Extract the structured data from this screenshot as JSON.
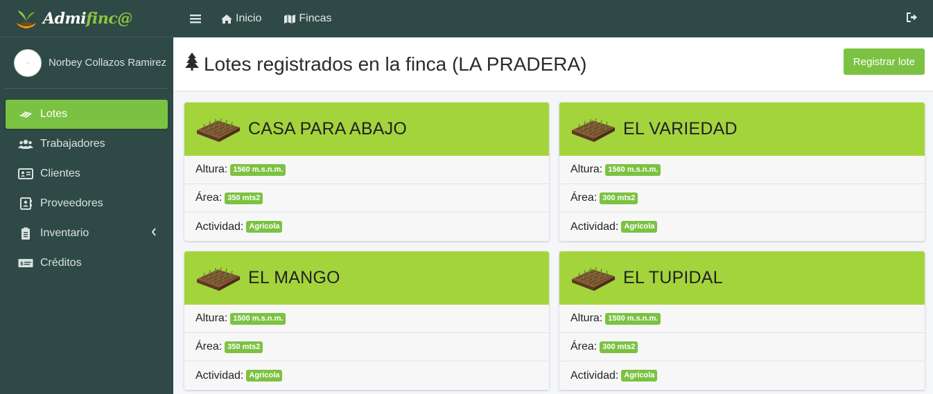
{
  "brand": {
    "name_part1": "Admi",
    "name_part2": "finc@"
  },
  "user": {
    "name": "Norbey Collazos Ramirez"
  },
  "sidebar": {
    "items": [
      {
        "label": "Lotes",
        "icon": "plot-icon",
        "active": true
      },
      {
        "label": "Trabajadores",
        "icon": "users-icon"
      },
      {
        "label": "Clientes",
        "icon": "id-card-icon"
      },
      {
        "label": "Proveedores",
        "icon": "contact-book-icon"
      },
      {
        "label": "Inventario",
        "icon": "clipboard-icon",
        "has_submenu": true
      },
      {
        "label": "Créditos",
        "icon": "money-bill-icon"
      }
    ]
  },
  "topbar": {
    "inicio": "Inicio",
    "fincas": "Fincas"
  },
  "page": {
    "title": "Lotes registrados en la finca (LA PRADERA)",
    "register_button": "Registrar lote"
  },
  "labels": {
    "altura": "Altura:",
    "area": "Área:",
    "actividad": "Actividad:"
  },
  "lotes": [
    {
      "name": "CASA PARA ABAJO",
      "altura": "1560 m.s.n.m.",
      "area": "350 mts2",
      "actividad": "Agricola"
    },
    {
      "name": "EL VARIEDAD",
      "altura": "1560 m.s.n.m.",
      "area": "300 mts2",
      "actividad": "Agricola"
    },
    {
      "name": "EL MANGO",
      "altura": "1500 m.s.n.m.",
      "area": "350 mts2",
      "actividad": "Agricola"
    },
    {
      "name": "EL TUPIDAL",
      "altura": "1500 m.s.n.m.",
      "area": "300 mts2",
      "actividad": "Agricola"
    }
  ],
  "colors": {
    "sidebar_bg": "#2f4a46",
    "accent_green": "#7cc242",
    "card_header": "#a3d43c"
  }
}
